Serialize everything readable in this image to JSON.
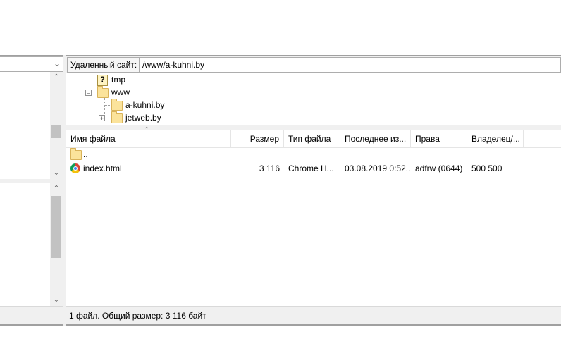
{
  "local": {
    "path_value": ""
  },
  "remote": {
    "site_label": "Удаленный сайт:",
    "site_path": "/www/a-kuhni.by",
    "tree": [
      {
        "name": "tmp",
        "icon": "question-folder-icon"
      },
      {
        "name": "www",
        "icon": "folder-icon",
        "expanded": true
      },
      {
        "name": "a-kuhni.by",
        "icon": "folder-icon"
      },
      {
        "name": "jetweb.by",
        "icon": "folder-icon",
        "collapsed": true
      }
    ],
    "columns": {
      "name": "Имя файла",
      "size": "Размер",
      "type": "Тип файла",
      "modified": "Последнее из...",
      "perms": "Права",
      "owner": "Владелец/..."
    },
    "rows": [
      {
        "name": "..",
        "size": "",
        "type": "",
        "modified": "",
        "perms": "",
        "owner": "",
        "icon": "folder-icon"
      },
      {
        "name": "index.html",
        "size": "3 116",
        "type": "Chrome H...",
        "modified": "03.08.2019 0:52...",
        "perms": "adfrw (0644)",
        "owner": "500 500",
        "icon": "chrome-icon"
      }
    ],
    "status": "1 файл. Общий размер: 3 116 байт"
  }
}
